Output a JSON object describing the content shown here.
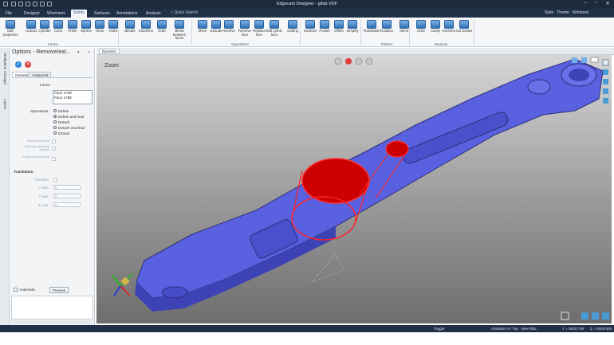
{
  "app": {
    "title": "Edgecam Designer - gifab VDF"
  },
  "tabs": [
    "File",
    "Designer",
    "Wireframe",
    "Solids",
    "Surfaces",
    "Annotations",
    "Analysis"
  ],
  "active_tab": "Solids",
  "quick_search": "Quick Search",
  "right_tabs": {
    "style": "Style",
    "theme": "Theme",
    "windows": "Windows"
  },
  "ribbon": {
    "buttons": [
      "Edit properties",
      "Cuboid",
      "Cylinder",
      "Cone",
      "Prism",
      "Sphere",
      "Torus",
      "Holes",
      "Blends",
      "Chamfers",
      "Draft",
      "Blend between faces",
      "Move",
      "Extrude",
      "Revolve",
      "Remove face",
      "Replace face",
      "Edit cylind. face",
      "Scaling",
      "Sections",
      "Pocket",
      "Offset",
      "Simplify",
      "Translation",
      "Rotation",
      "Mirror",
      "Unite",
      "Cavity",
      "Intersect",
      "Cut bodies"
    ],
    "groups": [
      "Forms",
      "Operations",
      "Pattern",
      "Boolean"
    ]
  },
  "left_strip": {
    "item1": "Workplane manager",
    "item2": "Layers"
  },
  "options_panel": {
    "title": "Options - Remove/ext...",
    "pin": "✦",
    "close": "×",
    "tabs": [
      "General",
      "Advanced"
    ],
    "faces_label": "Faces",
    "faces": [
      "Face 1749",
      "Face 1786"
    ],
    "operations_label": "Operations",
    "operations": [
      "Delete",
      "Delete and heal",
      "Detach",
      "Detach and heal",
      "Extract"
    ],
    "selected_operation": "Delete and heal",
    "opt1": "Remove internal",
    "opt2": "Set extra and heal surface",
    "opt3": "Extend healed faces",
    "translation_label": "Translation",
    "translation_enabled": "Translate",
    "x_label": "X axis",
    "y_label": "Y axis",
    "z_label": "Z axis",
    "x_val": "0",
    "y_val": "0",
    "z_val": "0",
    "automatic": "Automatic",
    "preview": "Preview"
  },
  "viewport": {
    "tab": "Dynamic",
    "zoom_label": "Zoom"
  },
  "status": {
    "toggle": "Toggle",
    "view": "Absolute XY Top",
    "view_rel": "View REL",
    "coords": "Y = 8533.799",
    "z": "Z = 0000.000"
  },
  "colors": {
    "part": "#5a61e0",
    "highlight": "#e00000"
  }
}
